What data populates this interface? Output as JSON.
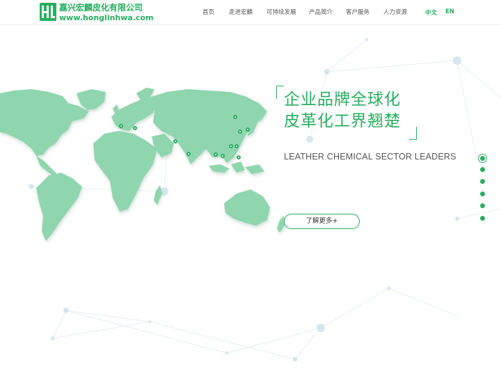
{
  "brand": {
    "name_cn": "嘉兴宏麟皮化有限公司",
    "domain": "www.honglinhwa.com",
    "logo_icon": "hl-logo-icon",
    "color": "#27ae60"
  },
  "nav": {
    "items": [
      {
        "label": "首页"
      },
      {
        "label": "走进宏麟"
      },
      {
        "label": "可持续发展"
      },
      {
        "label": "产品简介"
      },
      {
        "label": "客户服务"
      },
      {
        "label": "人力资源"
      }
    ],
    "lang_cn": "中文",
    "lang_en": "EN",
    "active_lang": "中文"
  },
  "hero": {
    "headline_line1": "企业品牌全球化",
    "headline_line2": "皮革化工界翘楚",
    "subheading": "LEATHER CHEMICAL SECTOR LEADERS",
    "more_button": "了解更多+",
    "map_icon": "world-map-icon",
    "map_color": "#8fd6ae",
    "marker_icon": "location-pin-icon",
    "marker_color": "#27ae60"
  },
  "pagination": {
    "total": 6,
    "active_index": 0
  }
}
